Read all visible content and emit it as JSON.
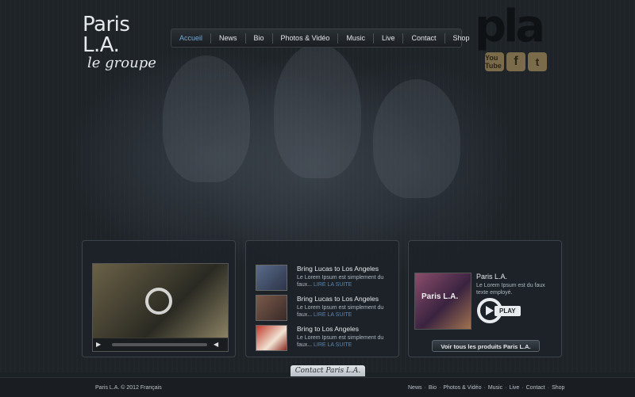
{
  "logo": {
    "title": "Paris L.A.",
    "subtitle": "le groupe"
  },
  "nav": {
    "items": [
      {
        "label": "Accueil",
        "active": true
      },
      {
        "label": "News"
      },
      {
        "label": "Bio"
      },
      {
        "label": "Photos & Vidéo"
      },
      {
        "label": "Music"
      },
      {
        "label": "Live"
      },
      {
        "label": "Contact"
      },
      {
        "label": "Shop"
      }
    ]
  },
  "brand_mark": "pla",
  "social": [
    {
      "name": "youtube-icon",
      "label": "You Tube"
    },
    {
      "name": "facebook-icon",
      "label": "f"
    },
    {
      "name": "twitter-icon",
      "label": "t"
    }
  ],
  "news": {
    "items": [
      {
        "title": "Bring Lucas to Los Angeles",
        "text": "Le Lorem Ipsum est simplement du faux...",
        "link": "LIRE LA SUITE"
      },
      {
        "title": "Bring Lucas to Los Angeles",
        "text": "Le Lorem Ipsum est simplement du faux...",
        "link": "LIRE LA SUITE"
      },
      {
        "title": "Bring   to Los Angeles",
        "text": "Le Lorem Ipsum est simplement du faux...",
        "link": "LIRE LA SUITE"
      }
    ]
  },
  "shop": {
    "album_text": "Paris L.A.",
    "title": "Paris L.A.",
    "text": "Le Lorem Ipsum est du faux texte employé.",
    "play_label": "PLAY",
    "button": "Voir tous les produits Paris L.A."
  },
  "contact_tab": "Contact Paris L.A.",
  "footer": {
    "left": "Paris L.A.  © 2012  Français",
    "links": [
      "News",
      "Bio",
      "Photos & Vidéo",
      "Music",
      "Live",
      "Contact",
      "Shop"
    ]
  },
  "colors": {
    "accent": "#6fa8d8",
    "link": "#5b86b0",
    "social": "#7a6b4a"
  }
}
